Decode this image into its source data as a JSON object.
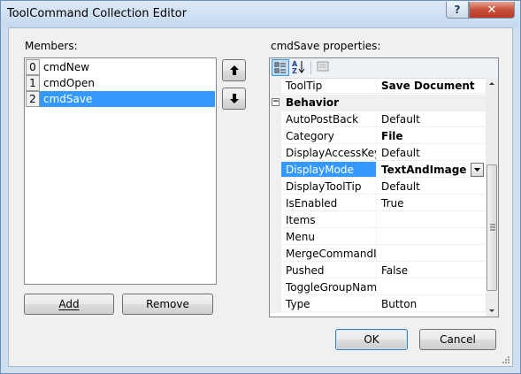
{
  "window": {
    "title": "ToolCommand Collection Editor",
    "help_glyph": "?",
    "close_glyph": "✕"
  },
  "members": {
    "label": "Members:",
    "items": [
      {
        "index": "0",
        "name": "cmdNew"
      },
      {
        "index": "1",
        "name": "cmdOpen"
      },
      {
        "index": "2",
        "name": "cmdSave"
      }
    ],
    "selected_index": 2
  },
  "buttons": {
    "add": "Add",
    "remove": "Remove",
    "ok": "OK",
    "cancel": "Cancel"
  },
  "properties": {
    "label": "cmdSave properties:",
    "rows": [
      {
        "kind": "prop",
        "name": "ToolTip",
        "value": "Save Document",
        "bold": true
      },
      {
        "kind": "category",
        "name": "Behavior",
        "expander": "−"
      },
      {
        "kind": "prop",
        "name": "AutoPostBack",
        "value": "Default"
      },
      {
        "kind": "prop",
        "name": "Category",
        "value": "File",
        "bold": true
      },
      {
        "kind": "prop",
        "name": "DisplayAccessKeyO",
        "value": "Default"
      },
      {
        "kind": "prop",
        "name": "DisplayMode",
        "value": "TextAndImage",
        "bold": true,
        "selected": true,
        "dropdown": true
      },
      {
        "kind": "prop",
        "name": "DisplayToolTip",
        "value": "Default"
      },
      {
        "kind": "prop",
        "name": "IsEnabled",
        "value": "True"
      },
      {
        "kind": "prop",
        "name": "Items",
        "value": ""
      },
      {
        "kind": "prop",
        "name": "Menu",
        "value": ""
      },
      {
        "kind": "prop",
        "name": "MergeCommandID",
        "value": ""
      },
      {
        "kind": "prop",
        "name": "Pushed",
        "value": "False"
      },
      {
        "kind": "prop",
        "name": "ToggleGroupName",
        "value": ""
      },
      {
        "kind": "prop",
        "name": "Type",
        "value": "Button"
      }
    ]
  },
  "colors": {
    "selection": "#3399ff",
    "frame": "#cfdfef",
    "close": "#c7503a"
  }
}
